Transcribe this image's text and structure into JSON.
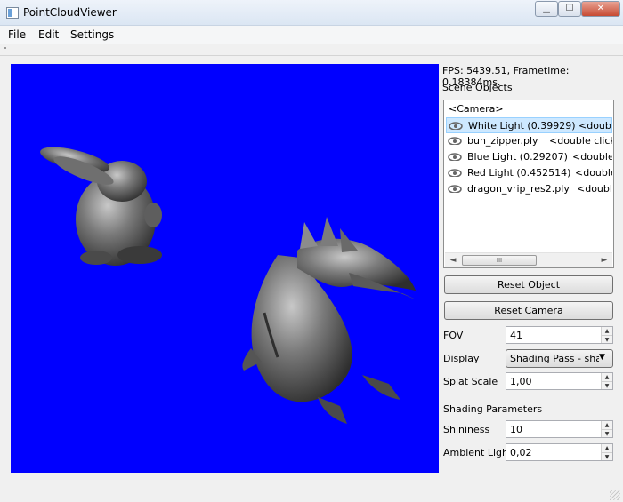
{
  "window": {
    "title": "PointCloudViewer",
    "minimize": "▁",
    "maximize": "☐",
    "close": "✕"
  },
  "menu": {
    "file": "File",
    "edit": "Edit",
    "settings": "Settings"
  },
  "stats": {
    "fps_text": "FPS: 5439.51, Frametime: 0.18384ms."
  },
  "scene": {
    "label": "Scene Objects",
    "camera": "<Camera>",
    "items": [
      {
        "label": "White Light (0.39929)",
        "hint": "<doub",
        "selected": true
      },
      {
        "label": "bun_zipper.ply",
        "hint": "<double click",
        "selected": false
      },
      {
        "label": "Blue Light (0.29207)",
        "hint": "<double",
        "selected": false
      },
      {
        "label": "Red Light (0.452514)",
        "hint": "<double",
        "selected": false
      },
      {
        "label": "dragon_vrip_res2.ply",
        "hint": "<doubl",
        "selected": false
      }
    ],
    "scroll_left": "◄",
    "scroll_right": "►",
    "thumb_grip": "III"
  },
  "buttons": {
    "reset_object": "Reset Object",
    "reset_camera": "Reset Camera"
  },
  "params": {
    "fov_label": "FOV",
    "fov_value": "41",
    "display_label": "Display",
    "display_value": "Shading Pass - shade",
    "splat_label": "Splat Scale",
    "splat_value": "1,00",
    "shading_title": "Shading Parameters",
    "shininess_label": "Shininess",
    "shininess_value": "10",
    "ambient_label": "Ambient Light",
    "ambient_value": "0,02"
  },
  "spin": {
    "up": "▲",
    "down": "▼"
  },
  "combo_arrow": "▼",
  "colors": {
    "viewport_bg": "#0000ff",
    "selection": "#cde8ff"
  }
}
